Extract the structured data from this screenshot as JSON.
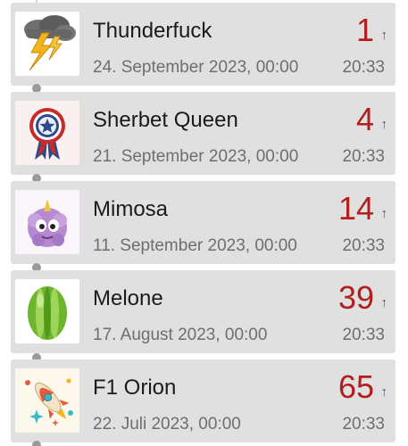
{
  "entries": [
    {
      "name": "Thunderfuck",
      "date": "24. September 2023, 00:00",
      "rank": "1",
      "time": "20:33",
      "icon": "thunderstorm-cloud-icon",
      "arrow": "↑"
    },
    {
      "name": "Sherbet Queen",
      "date": "21. September 2023, 00:00",
      "rank": "4",
      "time": "20:33",
      "icon": "award-rosette-icon",
      "arrow": "↑"
    },
    {
      "name": "Mimosa",
      "date": "11. September 2023, 00:00",
      "rank": "14",
      "time": "20:33",
      "icon": "purple-fluffy-monster-icon",
      "arrow": "↑"
    },
    {
      "name": "Melone",
      "date": "17. August 2023, 00:00",
      "rank": "39",
      "time": "20:33",
      "icon": "green-melon-egg-icon",
      "arrow": "↑"
    },
    {
      "name": "F1 Orion",
      "date": "22. Juli 2023, 00:00",
      "rank": "65",
      "time": "20:33",
      "icon": "rocket-icon",
      "arrow": "↑"
    }
  ],
  "colors": {
    "card_background": "#e0e0e0",
    "rank_color": "#b01e1e",
    "text_primary": "#1b1b1b",
    "text_secondary": "#6e6e6e",
    "timeline_dot": "#9a9a9a"
  }
}
